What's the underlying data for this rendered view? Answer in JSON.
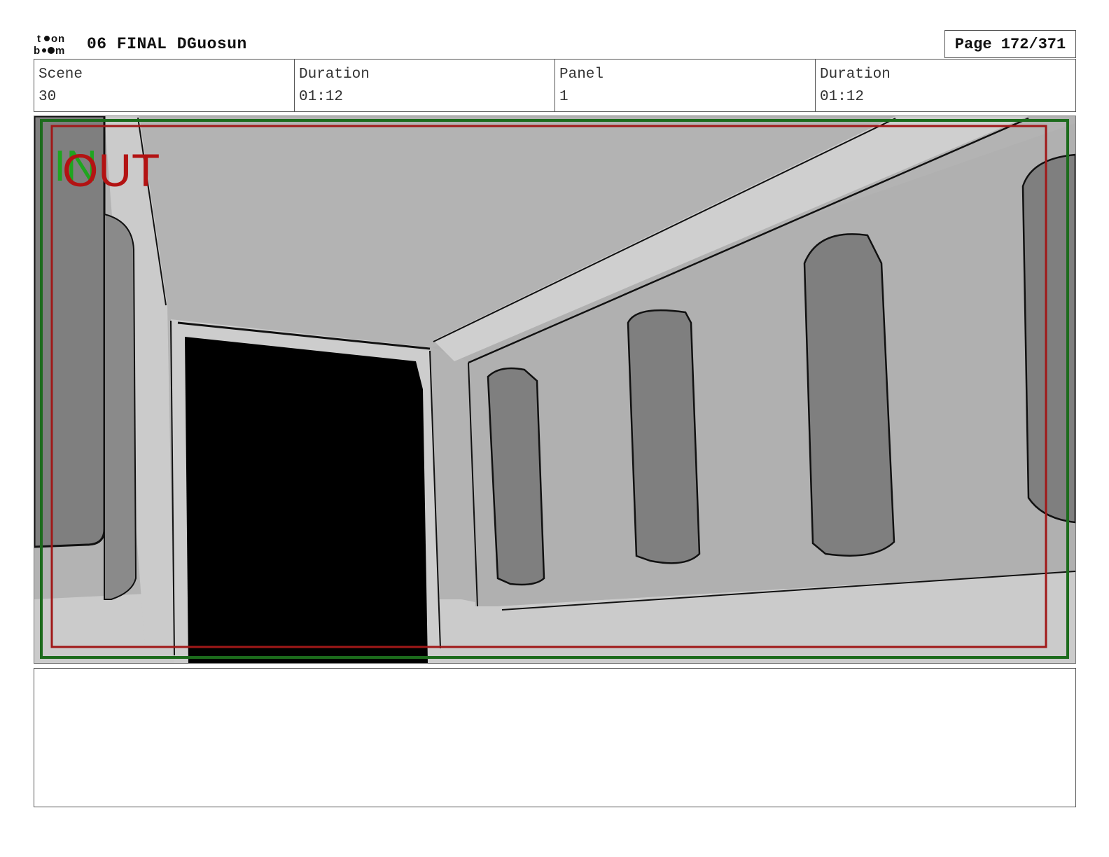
{
  "header": {
    "logo_text": "toon boom",
    "title": "06 FINAL DGuosun",
    "page": "Page 172/371"
  },
  "info": {
    "scene_label": "Scene",
    "scene_value": "30",
    "scene_duration_label": "Duration",
    "scene_duration_value": "01:12",
    "panel_label": "Panel",
    "panel_value": "1",
    "panel_duration_label": "Duration",
    "panel_duration_value": "01:12"
  },
  "panel": {
    "in_marker": "IN",
    "out_marker": "OUT",
    "colors": {
      "in_marker": "#1fa51f",
      "out_marker": "#b31313",
      "safe_frame": "#1c6b1c",
      "title_safe": "#a01818",
      "wall_light": "#cfcfcf",
      "wall_mid": "#b3b3b3",
      "window": "#7f7f7f",
      "doorway": "#000000"
    }
  },
  "notes": {
    "text": ""
  }
}
